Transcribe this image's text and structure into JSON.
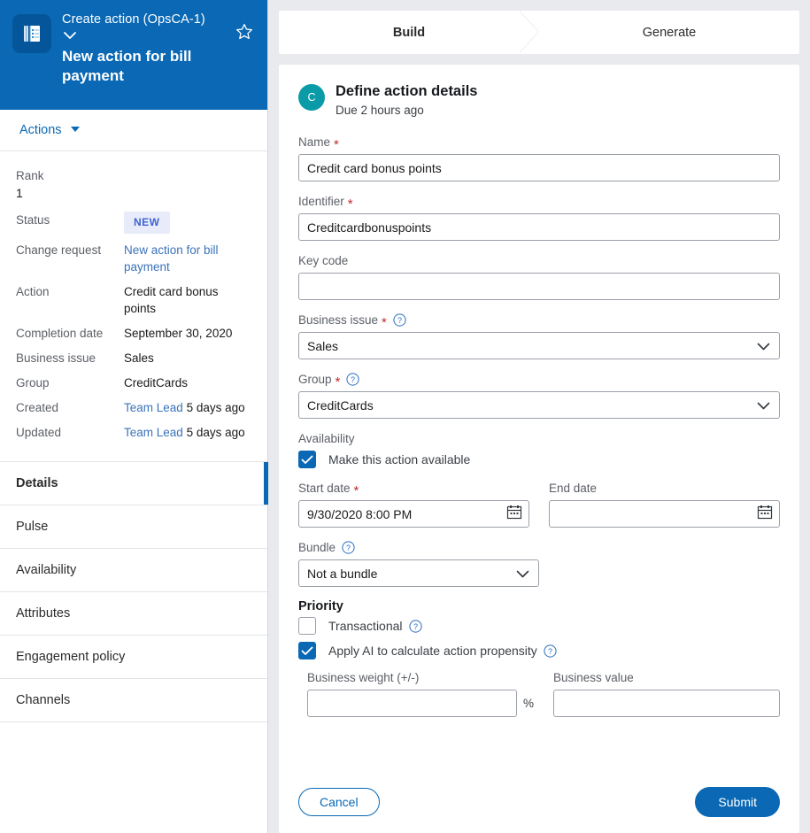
{
  "sidebar": {
    "header": {
      "app_icon": "notebook-list-icon",
      "kicker": "Create action  (OpsCA-1)",
      "title": "New action for bill payment",
      "star_icon": "star-icon",
      "chevron_icon": "chevron-down-icon"
    },
    "actions_menu": {
      "label": "Actions",
      "caret_icon": "caret-down-icon"
    },
    "meta": {
      "rank_label": "Rank",
      "rank_value": "1",
      "rows": [
        {
          "key": "Status",
          "value": "NEW",
          "type": "badge"
        },
        {
          "key": "Change request",
          "value": "New action for bill payment",
          "type": "link"
        },
        {
          "key": "Action",
          "value": "Credit card bonus points",
          "type": "text"
        },
        {
          "key": "Completion date",
          "value": "September 30, 2020",
          "type": "text"
        },
        {
          "key": "Business issue",
          "value": "Sales",
          "type": "text"
        },
        {
          "key": "Group",
          "value": "CreditCards",
          "type": "text"
        },
        {
          "key": "Created",
          "link": "Team Lead",
          "value": "5 days ago",
          "type": "user-time"
        },
        {
          "key": "Updated",
          "link": "Team Lead",
          "value": "5 days ago",
          "type": "user-time"
        }
      ]
    },
    "nav": [
      {
        "label": "Details",
        "active": true
      },
      {
        "label": "Pulse",
        "active": false
      },
      {
        "label": "Availability",
        "active": false
      },
      {
        "label": "Attributes",
        "active": false
      },
      {
        "label": "Engagement policy",
        "active": false
      },
      {
        "label": "Channels",
        "active": false
      }
    ]
  },
  "main": {
    "tabs": [
      {
        "label": "Build",
        "active": true
      },
      {
        "label": "Generate",
        "active": false
      }
    ],
    "step": {
      "avatar_initial": "C",
      "title": "Define action details",
      "due": "Due 2 hours ago"
    },
    "form": {
      "name": {
        "label": "Name",
        "required": true,
        "value": "Credit card bonus points",
        "placeholder": ""
      },
      "identifier": {
        "label": "Identifier",
        "required": true,
        "value": "Creditcardbonuspoints",
        "placeholder": ""
      },
      "key_code": {
        "label": "Key code",
        "required": false,
        "value": "",
        "placeholder": ""
      },
      "business_issue": {
        "label": "Business issue",
        "required": true,
        "value": "Sales",
        "help_icon": "help-circle-icon",
        "caret_icon": "chevron-down-icon"
      },
      "group": {
        "label": "Group",
        "required": true,
        "value": "CreditCards",
        "help_icon": "help-circle-icon",
        "caret_icon": "chevron-down-icon"
      },
      "availability": {
        "label": "Availability",
        "checkbox_label": "Make this action available",
        "checked": true
      },
      "start_date": {
        "label": "Start date",
        "required": true,
        "value": "9/30/2020 8:00 PM",
        "placeholder": "",
        "calendar_icon": "calendar-icon"
      },
      "end_date": {
        "label": "End date",
        "required": false,
        "value": "",
        "placeholder": "",
        "calendar_icon": "calendar-icon"
      },
      "bundle": {
        "label": "Bundle",
        "required": false,
        "value": "Not a bundle",
        "help_icon": "help-circle-icon",
        "caret_icon": "chevron-down-icon"
      },
      "priority": {
        "section_label": "Priority",
        "transactional": {
          "label": "Transactional",
          "checked": false,
          "help_icon": "help-circle-icon"
        },
        "apply_ai": {
          "label": "Apply AI to calculate action propensity",
          "checked": true,
          "help_icon": "help-circle-icon"
        },
        "business_weight": {
          "label": "Business weight (+/-)",
          "value": "",
          "placeholder": "",
          "suffix": "%"
        },
        "business_value": {
          "label": "Business value",
          "value": "",
          "placeholder": ""
        }
      }
    },
    "footer": {
      "cancel_label": "Cancel",
      "submit_label": "Submit"
    }
  },
  "colors": {
    "brand_blue": "#0a68b4",
    "header_blue": "#0a68b4",
    "icon_blue_dark": "#05559a",
    "avatar_teal": "#0b9aa8",
    "badge_bg": "#e8ecfa",
    "badge_text": "#3f63d2",
    "required_red": "#c02b2b",
    "page_bg": "#e8eaee",
    "link_blue": "#3b73b9"
  }
}
